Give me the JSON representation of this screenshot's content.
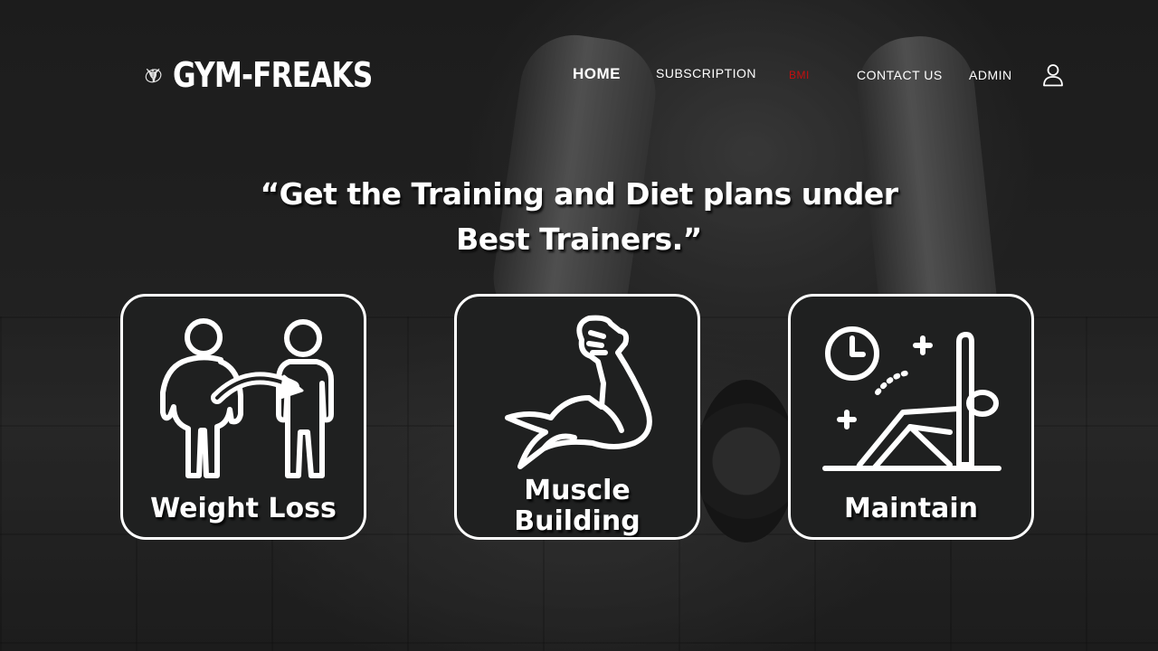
{
  "brand": {
    "name": "GYM-FREAKS",
    "logo_icon": "bodybuilder-emblem-icon"
  },
  "nav": {
    "home": "HOME",
    "subscription": "SUBSCRIPTION",
    "bmi": "BMI",
    "contact": "CONTACT US",
    "admin": "ADMIN",
    "user_icon": "user-icon"
  },
  "hero": {
    "quote_line1": "“Get the Training and Diet plans under",
    "quote_line2": "Best Trainers.”"
  },
  "cards": [
    {
      "label": "Weight Loss",
      "icon": "weight-loss-icon"
    },
    {
      "label_line1": "Muscle",
      "label_line2": "Building",
      "icon": "flexed-arm-icon"
    },
    {
      "label": "Maintain",
      "icon": "yoga-stretch-icon"
    }
  ],
  "colors": {
    "accent_bmi": "#c40f0f",
    "card_bg": "#1f2020",
    "text": "#ffffff"
  }
}
